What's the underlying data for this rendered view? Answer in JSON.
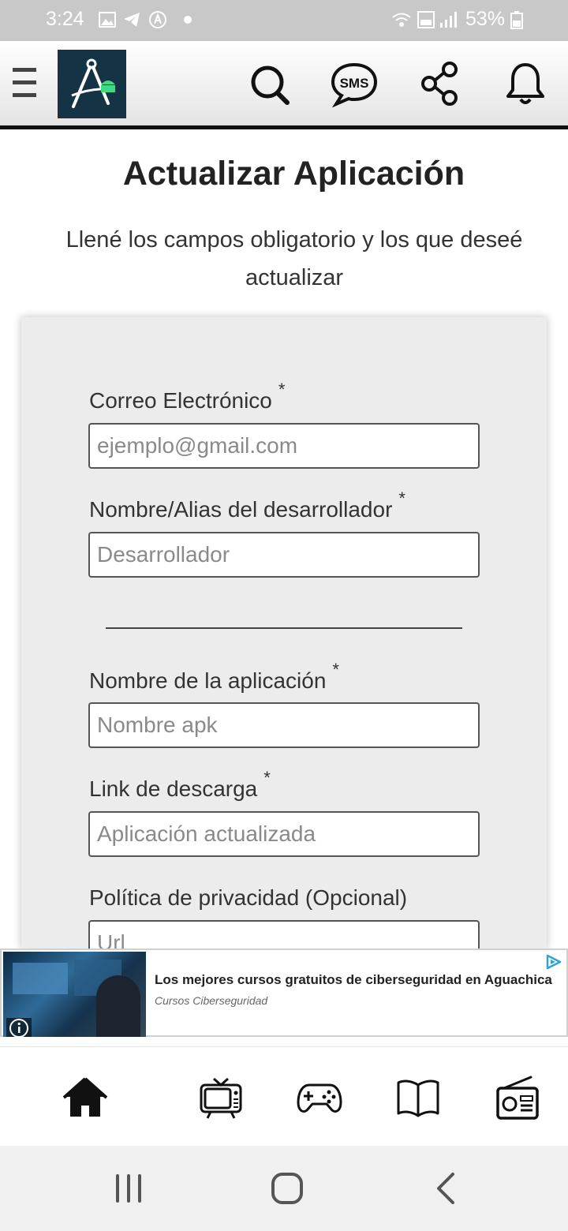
{
  "status_bar": {
    "time": "3:24",
    "battery": "53%"
  },
  "header": {
    "icons": [
      "menu-icon",
      "app-logo",
      "search-icon",
      "sms-icon",
      "share-icon",
      "bell-icon"
    ],
    "sms_label": "SMS"
  },
  "page": {
    "title": "Actualizar Aplicación",
    "subtitle": "Llené los campos obligatorio y los que deseé actualizar"
  },
  "form": {
    "email": {
      "label": "Correo Electrónico",
      "required": "*",
      "placeholder": "ejemplo@gmail.com"
    },
    "developer": {
      "label": "Nombre/Alias del desarrollador",
      "required": "*",
      "placeholder": "Desarrollador"
    },
    "app_name": {
      "label": "Nombre de la aplicación",
      "required": "*",
      "placeholder": "Nombre apk"
    },
    "download_link": {
      "label": "Link de descarga",
      "required": "*",
      "placeholder": "Aplicación actualizada"
    },
    "privacy": {
      "label": "Política de privacidad (Opcional)",
      "placeholder": "Url"
    }
  },
  "ad": {
    "title": "Los mejores cursos gratuitos de ciberseguridad en Aguachica",
    "source": "Cursos Ciberseguridad"
  },
  "bottom_nav": {
    "items": [
      "home-icon",
      "tv-icon",
      "gamepad-icon",
      "book-icon",
      "radio-icon"
    ]
  },
  "colors": {
    "status_bar": "#c8c8c8",
    "logo_bg": "#143446",
    "card_bg": "#ececec",
    "logo_accent": "#3ddc84"
  }
}
